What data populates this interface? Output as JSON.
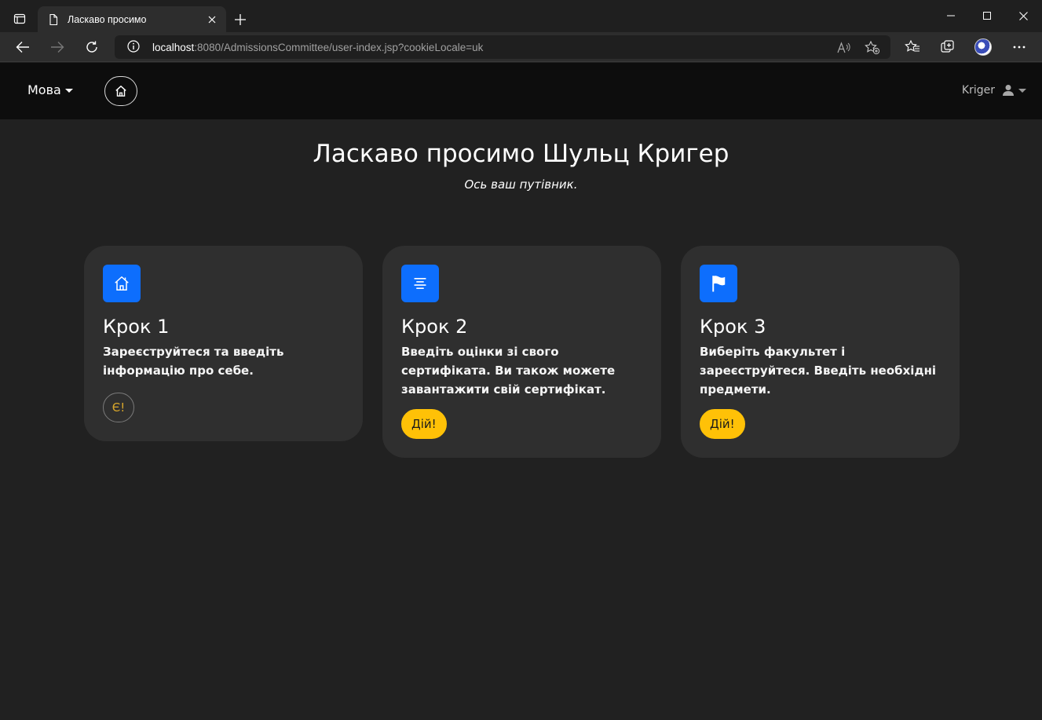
{
  "browser": {
    "tab_title": "Ласкаво просимо",
    "url_host": "localhost",
    "url_rest": ":8080/AdmissionsCommittee/user-index.jsp?cookieLocale=uk"
  },
  "navbar": {
    "language_label": "Мова",
    "username": "Kriger"
  },
  "hero": {
    "title": "Ласкаво просимо Шульц Кригер",
    "subtitle": "Ось ваш путівник."
  },
  "steps": [
    {
      "icon": "house-icon",
      "title": "Крок 1",
      "text": "Зареєструйтеся та введіть інформацію про себе.",
      "button": "Є!"
    },
    {
      "icon": "text-center-icon",
      "title": "Крок 2",
      "text": "Введіть оцінки зі свого сертифіката. Ви також можете завантажити свій сертифікат.",
      "button": "Дій!"
    },
    {
      "icon": "flag-icon",
      "title": "Крок 3",
      "text": "Виберіть факультет і зареєструйтеся. Введіть необхідні предмети.",
      "button": "Дій!"
    }
  ],
  "colors": {
    "accent_blue": "#0d6efd",
    "warning_yellow": "#ffc107",
    "card_bg": "#2f2f2f",
    "page_bg": "#212121"
  }
}
